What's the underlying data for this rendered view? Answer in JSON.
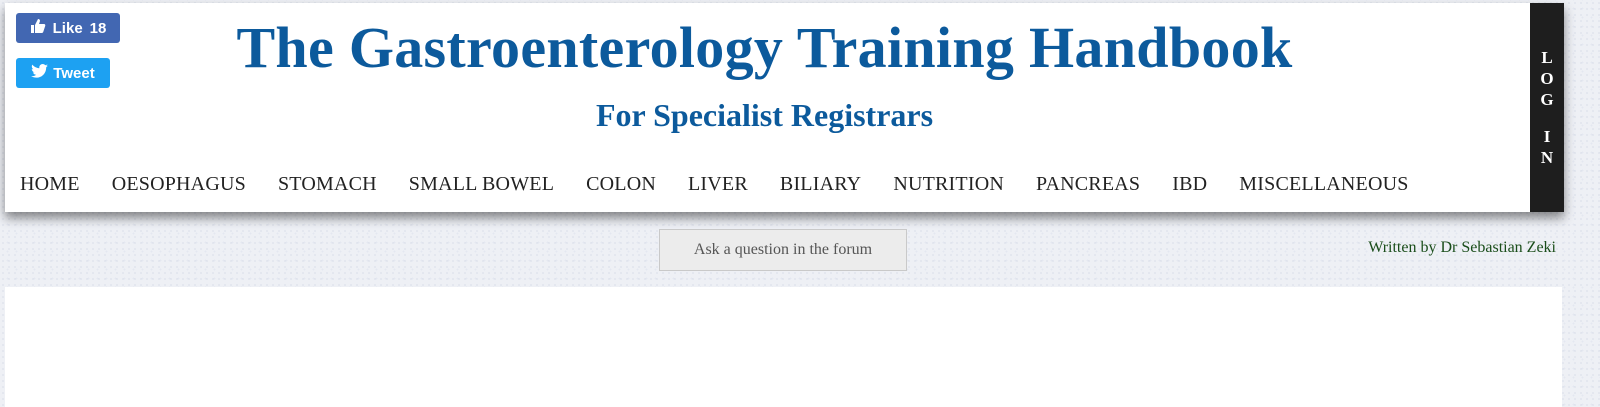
{
  "social": {
    "like_label": "Like",
    "like_count": "18",
    "like_color": "#4267b2",
    "like_icon": "thumbs-up-icon",
    "tweet_label": "Tweet",
    "tweet_color": "#1da1f2",
    "tweet_icon": "twitter-bird-icon"
  },
  "header": {
    "title": "The Gastroenterology Training Handbook",
    "subtitle": "For Specialist Registrars",
    "title_color": "#0c5a9c"
  },
  "nav": {
    "items": [
      "HOME",
      "OESOPHAGUS",
      "STOMACH",
      "SMALL BOWEL",
      "COLON",
      "LIVER",
      "BILIARY",
      "NUTRITION",
      "PANCREAS",
      "IBD",
      "MISCELLANEOUS"
    ]
  },
  "login": {
    "word1": [
      "L",
      "O",
      "G"
    ],
    "word2": [
      "I",
      "N"
    ]
  },
  "forum_button": {
    "label": "Ask a question in the forum"
  },
  "author": {
    "text": "Written by Dr Sebastian Zeki",
    "color": "#1a4d1a"
  }
}
